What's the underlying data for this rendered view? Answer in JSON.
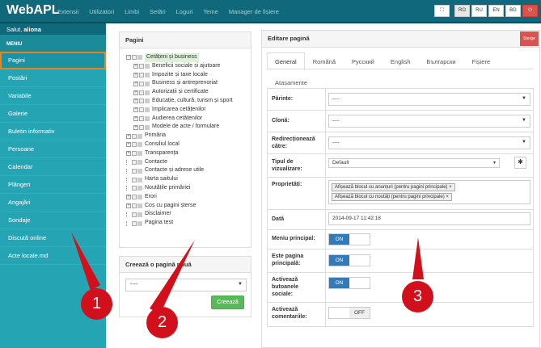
{
  "header": {
    "brand": "WebAPL",
    "nav": [
      "Extensii",
      "Utilizatori",
      "Limbi",
      "Setări",
      "Loguri",
      "Teme",
      "Manager de fișiere"
    ],
    "languages": [
      "RO",
      "RU",
      "EN",
      "BG"
    ]
  },
  "sidebar": {
    "greeting_prefix": "Salut, ",
    "user": "aliona",
    "menu_title": "MENIU",
    "items": [
      "Pagini",
      "Postări",
      "Variabile",
      "Galerie",
      "Buletin informativ",
      "Persoane",
      "Calendar",
      "Plângeri",
      "Angajări",
      "Sondaje",
      "Discută online",
      "Acte locale.md"
    ]
  },
  "pages_panel": {
    "title": "Pagini",
    "tree": [
      {
        "label": "Cetățeni și business",
        "level": 0,
        "toggle": "−",
        "selected": true
      },
      {
        "label": "Beneficii sociale și ajutoare",
        "level": 1,
        "toggle": "+"
      },
      {
        "label": "Impozite și taxe locale",
        "level": 1,
        "toggle": "+"
      },
      {
        "label": "Business și antreprenoriat",
        "level": 1,
        "toggle": "+"
      },
      {
        "label": "Autorizații și certificate",
        "level": 1,
        "toggle": "+"
      },
      {
        "label": "Educație, cultură, turism și sport",
        "level": 1,
        "toggle": "+"
      },
      {
        "label": "Implicarea cetățenilor",
        "level": 1,
        "toggle": "+"
      },
      {
        "label": "Audierea cetățenilor",
        "level": 1,
        "toggle": "+"
      },
      {
        "label": "Modele de acte / formulare",
        "level": 1,
        "toggle": "+"
      },
      {
        "label": "Primăria",
        "level": 0,
        "toggle": "+"
      },
      {
        "label": "Consiliul local",
        "level": 0,
        "toggle": "+"
      },
      {
        "label": "Transparența",
        "level": 0,
        "toggle": "+"
      },
      {
        "label": "Contacte",
        "level": 0,
        "toggle": ""
      },
      {
        "label": "Contacte și adrese utile",
        "level": 0,
        "toggle": ""
      },
      {
        "label": "Harta saitului",
        "level": 0,
        "toggle": ""
      },
      {
        "label": "Noutățile primăriei",
        "level": 0,
        "toggle": ""
      },
      {
        "label": "Erori",
        "level": 0,
        "toggle": "+"
      },
      {
        "label": "Coș cu pagini șterse",
        "level": 0,
        "toggle": "+"
      },
      {
        "label": "Disclaimer",
        "level": 0,
        "toggle": ""
      },
      {
        "label": "Pagina test",
        "level": 0,
        "toggle": ""
      }
    ]
  },
  "create_panel": {
    "title": "Creează o pagină nouă",
    "select_value": "----",
    "button": "Creează"
  },
  "edit_panel": {
    "title": "Editare pagină",
    "delete_button": "Șterge",
    "tabs": [
      "General",
      "Română",
      "Русский",
      "English",
      "Български",
      "Fișiere",
      "Atașamente"
    ],
    "fields": {
      "parent_label": "Părinte:",
      "parent_value": "----",
      "clone_label": "Clonă:",
      "clone_value": "----",
      "redirect_label": "Redirecționează către:",
      "redirect_value": "----",
      "view_type_label": "Tipul de vizualizare:",
      "view_type_value": "Default",
      "properties_label": "Proprietăți:",
      "properties": [
        "Afișează blocul cu anunțuri (pentru pagini principale)",
        "Afișează blocul cu noutăți (pentru pagini principale)"
      ],
      "date_label": "Dată",
      "date_value": "2014-09-17 11:42:18",
      "main_menu_label": "Meniu principal:",
      "main_menu_state": "ON",
      "main_page_label": "Este pagina principală:",
      "main_page_state": "ON",
      "social_label": "Activează butoanele sociale:",
      "social_state": "ON",
      "comments_label": "Activează comentariile:",
      "comments_state": "OFF"
    }
  },
  "annotations": [
    "1",
    "2",
    "3"
  ],
  "colors": {
    "topbar": "#10697a",
    "sidebar": "#25a4b4",
    "highlight": "#f0821e",
    "annotation": "#d1101b",
    "create_button": "#5cb85c"
  }
}
